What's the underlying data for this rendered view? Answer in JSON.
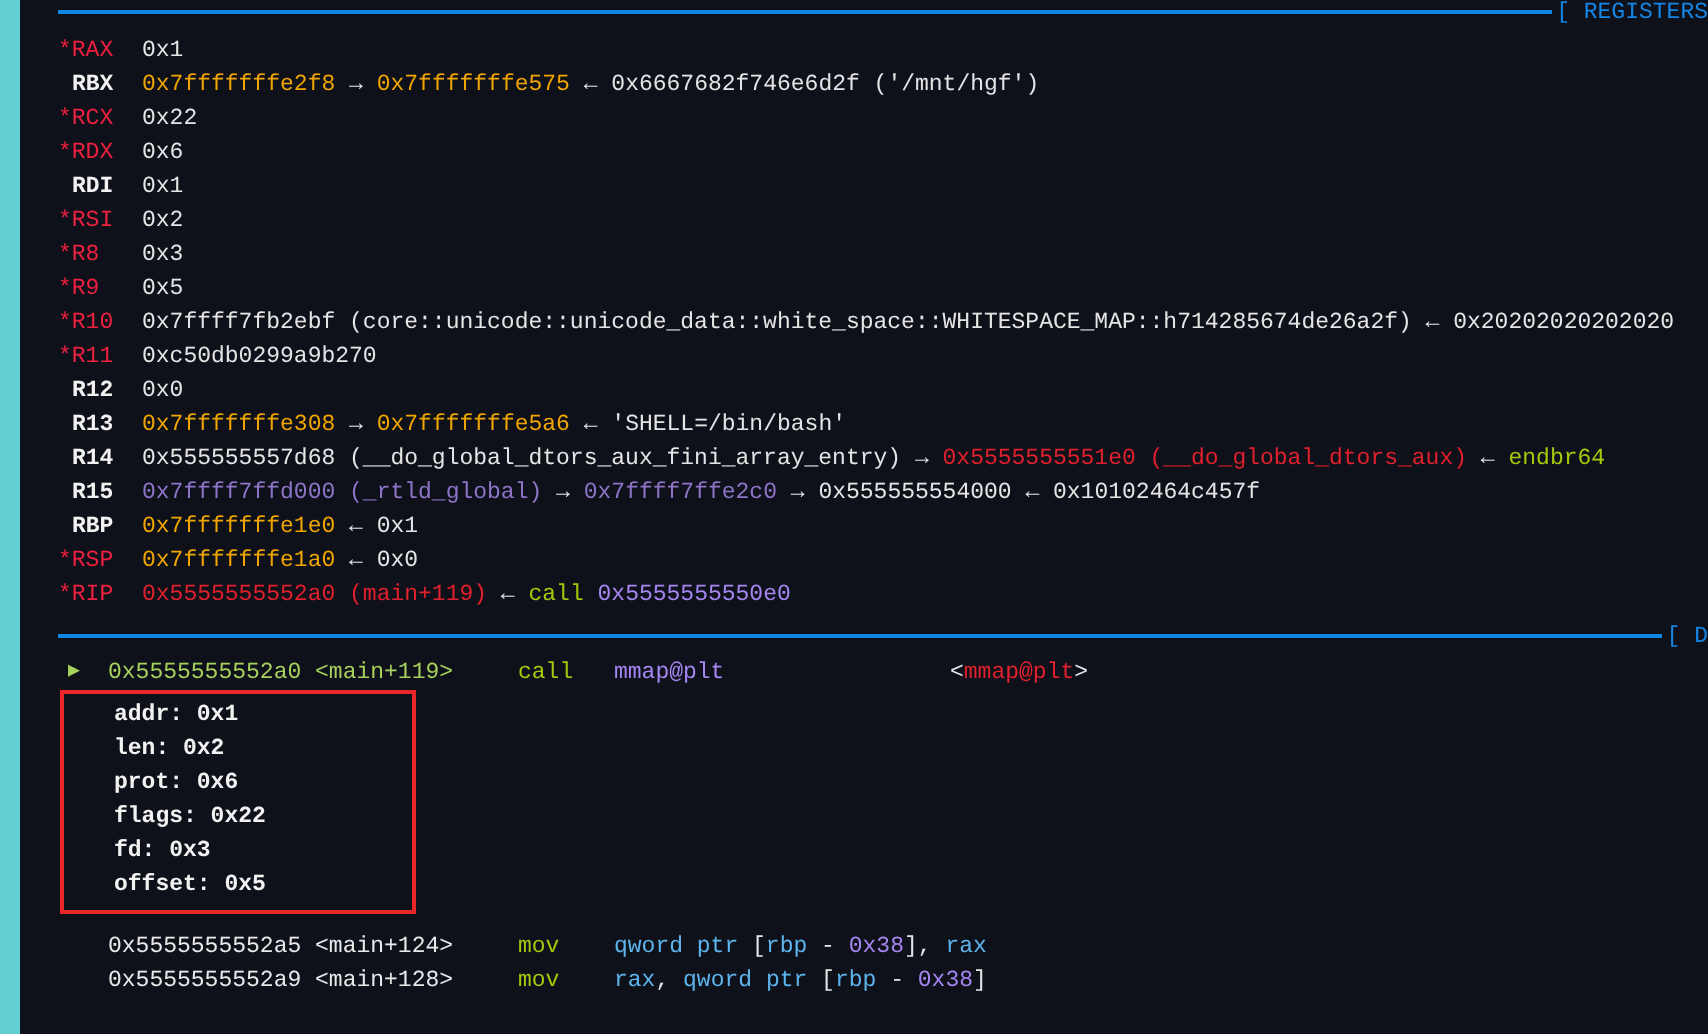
{
  "registers_header": "[ REGISTERS",
  "registers": [
    {
      "name": "*RAX",
      "changed": true,
      "segments": [
        {
          "text": "0x1",
          "kind": "plain"
        }
      ]
    },
    {
      "name": "RBX",
      "changed": false,
      "segments": [
        {
          "text": "0x7fffffffe2f8",
          "kind": "stack"
        },
        {
          "text": " → ",
          "kind": "plain"
        },
        {
          "text": "0x7fffffffe575",
          "kind": "stack"
        },
        {
          "text": " ← 0x6667682f746e6d2f ('/mnt/hgf')",
          "kind": "plain"
        }
      ]
    },
    {
      "name": "*RCX",
      "changed": true,
      "segments": [
        {
          "text": "0x22",
          "kind": "plain"
        }
      ]
    },
    {
      "name": "*RDX",
      "changed": true,
      "segments": [
        {
          "text": "0x6",
          "kind": "plain"
        }
      ]
    },
    {
      "name": "RDI",
      "changed": false,
      "segments": [
        {
          "text": "0x1",
          "kind": "plain"
        }
      ]
    },
    {
      "name": "*RSI",
      "changed": true,
      "segments": [
        {
          "text": "0x2",
          "kind": "plain"
        }
      ]
    },
    {
      "name": "*R8",
      "changed": true,
      "segments": [
        {
          "text": "0x3",
          "kind": "plain"
        }
      ]
    },
    {
      "name": "*R9",
      "changed": true,
      "segments": [
        {
          "text": "0x5",
          "kind": "plain"
        }
      ]
    },
    {
      "name": "*R10",
      "changed": true,
      "segments": [
        {
          "text": "0x7ffff7fb2ebf (core::unicode::unicode_data::white_space::WHITESPACE_MAP::h714285674de26a2f) ← 0x20202020202020",
          "kind": "plain"
        }
      ]
    },
    {
      "name": "*R11",
      "changed": true,
      "segments": [
        {
          "text": "0xc50db0299a9b270",
          "kind": "plain"
        }
      ]
    },
    {
      "name": "R12",
      "changed": false,
      "segments": [
        {
          "text": "0x0",
          "kind": "plain"
        }
      ]
    },
    {
      "name": "R13",
      "changed": false,
      "segments": [
        {
          "text": "0x7fffffffe308",
          "kind": "stack"
        },
        {
          "text": " → ",
          "kind": "plain"
        },
        {
          "text": "0x7fffffffe5a6",
          "kind": "stack"
        },
        {
          "text": " ← 'SHELL=/bin/bash'",
          "kind": "plain"
        }
      ]
    },
    {
      "name": "R14",
      "changed": false,
      "segments": [
        {
          "text": "0x555555557d68 (__do_global_dtors_aux_fini_array_entry) → ",
          "kind": "plain"
        },
        {
          "text": "0x5555555551e0 (__do_global_dtors_aux)",
          "kind": "code"
        },
        {
          "text": " ← ",
          "kind": "plain"
        },
        {
          "text": "endbr64",
          "kind": "instr"
        }
      ]
    },
    {
      "name": "R15",
      "changed": false,
      "segments": [
        {
          "text": "0x7ffff7ffd000 (_rtld_global)",
          "kind": "data"
        },
        {
          "text": " → ",
          "kind": "plain"
        },
        {
          "text": "0x7ffff7ffe2c0",
          "kind": "data"
        },
        {
          "text": " → 0x555555554000 ← 0x10102464c457f",
          "kind": "plain"
        }
      ]
    },
    {
      "name": "RBP",
      "changed": false,
      "segments": [
        {
          "text": "0x7fffffffe1e0",
          "kind": "stack"
        },
        {
          "text": " ← 0x1",
          "kind": "plain"
        }
      ]
    },
    {
      "name": "*RSP",
      "changed": true,
      "segments": [
        {
          "text": "0x7fffffffe1a0",
          "kind": "stack"
        },
        {
          "text": " ← 0x0",
          "kind": "plain"
        }
      ]
    },
    {
      "name": "*RIP",
      "changed": true,
      "segments": [
        {
          "text": "0x5555555552a0 (main+119)",
          "kind": "code"
        },
        {
          "text": " ← ",
          "kind": "plain"
        },
        {
          "text": "call",
          "kind": "instr"
        },
        {
          "text": " 0x5555555550e0",
          "kind": "num"
        }
      ]
    }
  ],
  "disasm_header": "[ D",
  "disasm": [
    {
      "current": true,
      "marker": "▶",
      "address": "0x5555555552a0 <main+119>",
      "mnemonic": "call",
      "operands": [
        {
          "text": "mmap@plt",
          "kind": "num"
        }
      ],
      "comment": [
        {
          "text": "<",
          "kind": "plain"
        },
        {
          "text": "mmap@plt",
          "kind": "code"
        },
        {
          "text": ">",
          "kind": "plain"
        }
      ],
      "args": [
        "addr: 0x1",
        "len: 0x2",
        "prot: 0x6",
        "flags: 0x22",
        "fd: 0x3",
        "offset: 0x5"
      ]
    },
    {
      "current": false,
      "address": "0x5555555552a5 <main+124>",
      "mnemonic": "mov",
      "operands": [
        {
          "text": "qword ptr ",
          "kind": "reg"
        },
        {
          "text": "[",
          "kind": "plain"
        },
        {
          "text": "rbp",
          "kind": "reg"
        },
        {
          "text": " - ",
          "kind": "plain"
        },
        {
          "text": "0x38",
          "kind": "num"
        },
        {
          "text": "], ",
          "kind": "plain"
        },
        {
          "text": "rax",
          "kind": "reg"
        }
      ]
    },
    {
      "current": false,
      "address": "0x5555555552a9 <main+128>",
      "mnemonic": "mov",
      "operands": [
        {
          "text": "rax",
          "kind": "reg"
        },
        {
          "text": ", ",
          "kind": "plain"
        },
        {
          "text": "qword ptr ",
          "kind": "reg"
        },
        {
          "text": "[",
          "kind": "plain"
        },
        {
          "text": "rbp",
          "kind": "reg"
        },
        {
          "text": " - ",
          "kind": "plain"
        },
        {
          "text": "0x38",
          "kind": "num"
        },
        {
          "text": "]",
          "kind": "plain"
        }
      ]
    }
  ]
}
